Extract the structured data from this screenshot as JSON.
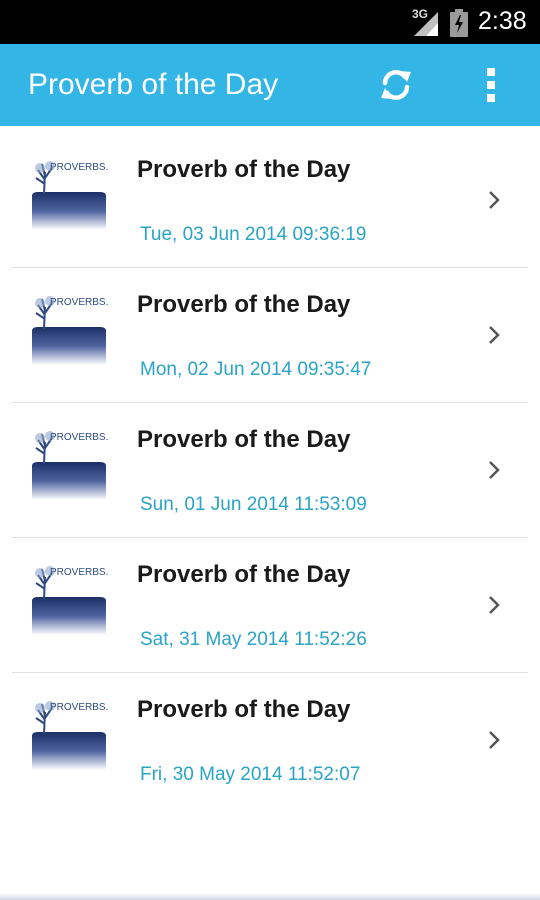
{
  "status_bar": {
    "network": "3G",
    "time": "2:38"
  },
  "action_bar": {
    "title": "Proverb of the Day",
    "refresh_icon": "refresh-icon",
    "overflow_icon": "overflow-menu-icon",
    "color": "#33b5e5"
  },
  "list": {
    "items": [
      {
        "logo_text": "PROVERBS.",
        "title": "Proverb of the Day",
        "date": "Tue, 03 Jun 2014 09:36:19"
      },
      {
        "logo_text": "PROVERBS.",
        "title": "Proverb of the Day",
        "date": "Mon, 02 Jun 2014 09:35:47"
      },
      {
        "logo_text": "PROVERBS.",
        "title": "Proverb of the Day",
        "date": "Sun, 01 Jun 2014 11:53:09"
      },
      {
        "logo_text": "PROVERBS.",
        "title": "Proverb of the Day",
        "date": "Sat, 31 May 2014 11:52:26"
      },
      {
        "logo_text": "PROVERBS.",
        "title": "Proverb of the Day",
        "date": "Fri, 30 May 2014 11:52:07"
      }
    ],
    "date_color": "#29a3c6",
    "chevron_icon": "chevron-right-icon"
  }
}
